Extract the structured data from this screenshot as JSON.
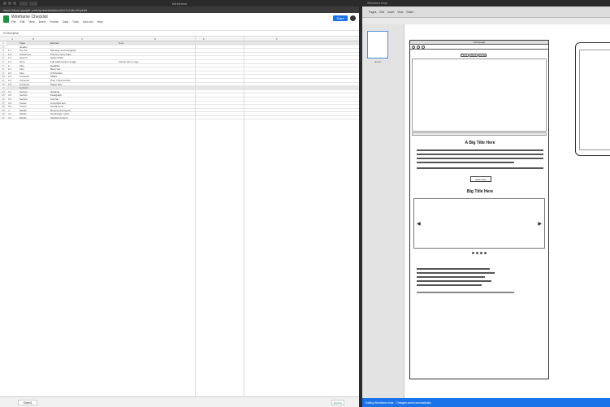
{
  "left_window": {
    "title": "Wireframe",
    "address": "https://docs.google.com/spreadsheets/d/1xYzLMnoPq/edit",
    "sheet_title": "Wireframe Checklist",
    "menu": [
      "File",
      "Edit",
      "View",
      "Insert",
      "Format",
      "Data",
      "Tools",
      "Add-ons",
      "Help"
    ],
    "share_label": "Share",
    "formula": "fx   Description",
    "col_headers": [
      "A",
      "B",
      "C",
      "D",
      "E",
      "F"
    ],
    "rows": [
      {
        "n": "1",
        "sec": true,
        "a": "",
        "b": "Page",
        "c": "Element",
        "d": "Note"
      },
      {
        "n": "2",
        "a": "",
        "b": "Header",
        "c": "",
        "d": ""
      },
      {
        "n": "3",
        "a": "1.1",
        "b": "Top bar",
        "c": "Site logo and navigation",
        "d": ""
      },
      {
        "n": "4",
        "a": "1.2",
        "b": "Global nav",
        "c": "Primary menu links",
        "d": ""
      },
      {
        "n": "5",
        "a": "1.3",
        "b": "Search",
        "c": "Search field",
        "d": ""
      },
      {
        "n": "6",
        "a": "1.4",
        "b": "Hero",
        "c": "Full width banner image",
        "d": "Placeholder image"
      },
      {
        "n": "7",
        "a": "2",
        "b": "Intro",
        "c": "Headline",
        "d": ""
      },
      {
        "n": "8",
        "a": "2.1",
        "b": "Intro",
        "c": "Body text",
        "d": ""
      },
      {
        "n": "9",
        "a": "2.2",
        "b": "Intro",
        "c": "CTA button",
        "d": ""
      },
      {
        "n": "10",
        "a": "2.3",
        "b": "Carousel",
        "c": "Slides",
        "d": ""
      },
      {
        "n": "11",
        "a": "2.4",
        "b": "Carousel",
        "c": "Prev / Next arrows",
        "d": ""
      },
      {
        "n": "12",
        "a": "2.5",
        "b": "Carousel",
        "c": "Pager dots",
        "d": ""
      },
      {
        "n": "13",
        "sec": true,
        "a": "",
        "b": "Content",
        "c": "",
        "d": ""
      },
      {
        "n": "14",
        "a": "3.1",
        "b": "Section",
        "c": "Heading",
        "d": ""
      },
      {
        "n": "15",
        "a": "3.2",
        "b": "Section",
        "c": "Paragraph",
        "d": ""
      },
      {
        "n": "16",
        "a": "3.3",
        "b": "Section",
        "c": "Link list",
        "d": ""
      },
      {
        "n": "17",
        "a": "3.4",
        "b": "Footer",
        "c": "Copyright text",
        "d": ""
      },
      {
        "n": "18",
        "a": "3.5",
        "b": "Footer",
        "c": "Social icons",
        "d": ""
      },
      {
        "n": "19",
        "a": "4",
        "b": "Mobile",
        "c": "Responsive layout",
        "d": ""
      },
      {
        "n": "20",
        "a": "4.1",
        "b": "Mobile",
        "c": "Hamburger menu",
        "d": ""
      },
      {
        "n": "21",
        "a": "4.2",
        "b": "Mobile",
        "c": "Stacked content",
        "d": ""
      }
    ],
    "sheet_tab": "Sheet1",
    "explore_label": "Explore"
  },
  "right_window": {
    "title": "Wireframe.bmpr",
    "toolbar": [
      "Pages",
      "Edit",
      "Insert",
      "View",
      "Share"
    ],
    "page_label": "Home",
    "browser_title": "Homepage",
    "nav_buttons": [
      "Home",
      "About",
      "Contact"
    ],
    "heading1": "A Big Title Here",
    "cta": "Click Here",
    "heading2": "Big Title Here",
    "status": "Editing Wireframe.bmpr - Changes saved automatically"
  }
}
